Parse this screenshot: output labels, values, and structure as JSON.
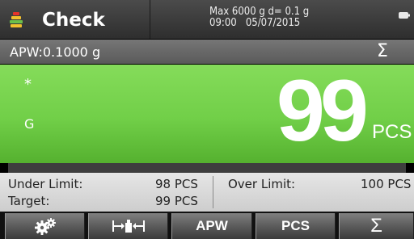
{
  "header": {
    "title": "Check",
    "capacity": "Max 6000 g  d= 0.1 g",
    "time": "09:00",
    "date": "05/07/2015",
    "app_icon": "checkweigh-stack-icon",
    "power_icon": "battery-icon"
  },
  "apw_line": {
    "text": "APW:0.1000 g",
    "sum_symbol": "Σ"
  },
  "display": {
    "stable_indicator": "*",
    "mode_indicator": "G",
    "value": "99",
    "unit": "PCS",
    "background_color": "#71cf48"
  },
  "limits": {
    "under_label": "Under Limit:",
    "under_value": "98 PCS",
    "target_label": "Target:",
    "target_value": "99 PCS",
    "over_label": "Over Limit:",
    "over_value": "100 PCS"
  },
  "softkeys": {
    "settings_icon": "gears-icon",
    "tare_icon": "tare-icon",
    "apw_label": "APW",
    "pcs_label": "PCS",
    "sum_label": "Σ"
  }
}
